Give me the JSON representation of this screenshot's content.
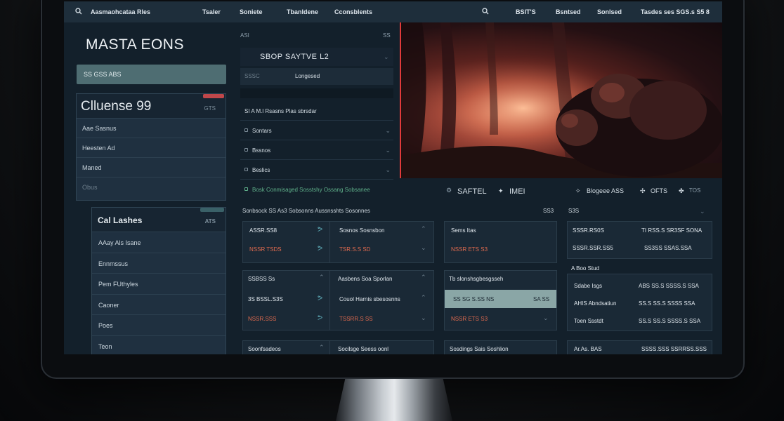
{
  "topbar": {
    "left_title": "Aasmaohcataa Rles",
    "nav": [
      "Tsaler",
      "Soniete",
      "Tbanldene",
      "Cconsblents"
    ],
    "right": [
      "BSIT'S",
      "Bsntsed",
      "Sonlsed",
      "Tasdes ses SGS.s S5 8"
    ]
  },
  "brand": "MASTA EONS",
  "left_button": "SS GSS ABS",
  "panel_a": {
    "title": "Clluense 99",
    "tag": "GTS",
    "rows": [
      "Aae Sasnus",
      "Heesten Ad",
      "Maned",
      "Obus"
    ]
  },
  "panel_b": {
    "title": "Cal Lashes",
    "tag": "ATS",
    "rows": [
      "AAay Als Isane",
      "Ennmssus",
      "Pem FUthyles",
      "Caoner",
      "Poes",
      "Teon"
    ]
  },
  "middle": {
    "tag_left": "ASI",
    "tag_right": "SS",
    "title": "SBOP SAYTVE L2",
    "sub_left": "SSSC",
    "sub_label": "Longesed",
    "header": "SI A M.l Rsasns Plas sbrsdar",
    "rows": [
      "Sontars",
      "Bssnos",
      "Beslics"
    ],
    "green_line": "Bosk Conmisaged Sosstshy Ossang Sobsanee"
  },
  "caption": {
    "left": "SAFTEL",
    "left2": "IMEI",
    "right": "Blogeee ASS",
    "right2": "OFTS",
    "right3": "TOS"
  },
  "section": {
    "title": "Sonbsock SS As3 Sobsonns Aussnsshts Sosonnes",
    "right1": "SS3",
    "right2": "S3S"
  },
  "cards": {
    "c1": {
      "r1": [
        "ASSR.SS8",
        "Sosnos Sosnsbon"
      ],
      "r2": [
        "NSSR TSDS",
        "TSR.S.S SD"
      ],
      "r3": [
        "SSBSS Ss",
        "Aasbens Soa Sporlan"
      ],
      "r4": [
        "3S BSSL.S3S",
        "Couol Harnis sbesosnns"
      ],
      "r5": [
        "NSSR.SSS",
        "TSSRR.S SS"
      ],
      "r6": [
        "Soonfsadeos",
        "Socilsge Seess oonl"
      ]
    },
    "c2": {
      "r1": "Sems Itas",
      "r2": "NSSR ETS S3",
      "r3": "Tb slonshsgbesgsseh",
      "r4": [
        "SS SG S.SS NS",
        "SA SS"
      ],
      "r5": "NSSR ETS S3",
      "r6": "Sosdings Sais Soshlion"
    },
    "c3": {
      "r1": [
        "SSSR.RS0S",
        "TI RSS.S SR3SF SONA"
      ],
      "r2": [
        "SSSR.SSR.SS5",
        "SS3SS SSAS.SSA"
      ],
      "r3": "A Boo Stud",
      "r4": [
        "Sdabe Isgs",
        "ABS SS.S SSSS.S SSA"
      ],
      "r5": [
        "AHIS Abndsatiun",
        "SS.S SS.S SSSS SSA"
      ],
      "r6": [
        "Toen Ssstdt",
        "SS.S SS.S SSSS.S SSA"
      ],
      "r7": [
        "Ar.As. BAS",
        "SSSS.SSS SSRRSS.SSS"
      ]
    }
  }
}
